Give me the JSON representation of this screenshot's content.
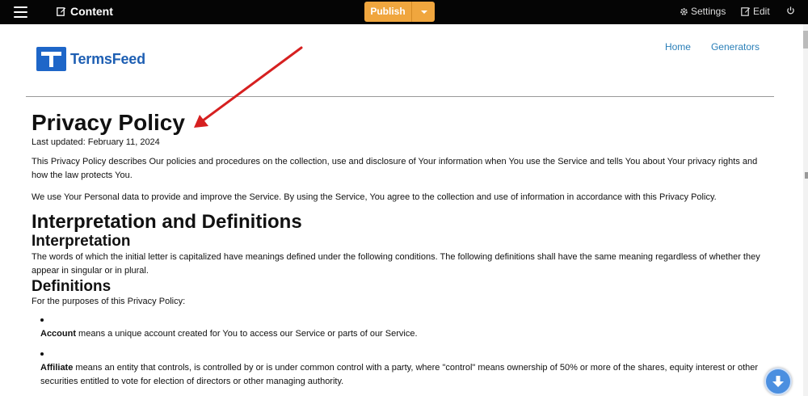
{
  "topbar": {
    "content_label": "Content",
    "publish_label": "Publish",
    "settings_label": "Settings",
    "edit_label": "Edit"
  },
  "site": {
    "brand": "TermsFeed",
    "nav": [
      "Home",
      "Generators"
    ]
  },
  "policy": {
    "title": "Privacy Policy",
    "updated": "Last updated: February 11, 2024",
    "intro1": "This Privacy Policy describes Our policies and procedures on the collection, use and disclosure of Your information when You use the Service and tells You about Your privacy rights and how the law protects You.",
    "intro2": "We use Your Personal data to provide and improve the Service. By using the Service, You agree to the collection and use of information in accordance with this Privacy Policy.",
    "section_heading": "Interpretation and Definitions",
    "interpretation_heading": "Interpretation",
    "interpretation_text": "The words of which the initial letter is capitalized have meanings defined under the following conditions. The following definitions shall have the same meaning regardless of whether they appear in singular or in plural.",
    "definitions_heading": "Definitions",
    "definitions_intro": "For the purposes of this Privacy Policy:",
    "definitions": [
      {
        "term": "Account",
        "text": " means a unique account created for You to access our Service or parts of our Service."
      },
      {
        "term": "Affiliate",
        "text": " means an entity that controls, is controlled by or is under common control with a party, where \"control\" means ownership of 50% or more of the shares, equity interest or other securities entitled to vote for election of directors or other managing authority."
      }
    ]
  },
  "colors": {
    "topbar_bg": "#050505",
    "publish": "#f0a63e",
    "brand_blue": "#1e66c8",
    "link": "#2a7fb8",
    "annotation_arrow": "#d62020"
  },
  "icons": [
    "menu-icon",
    "pencil-icon",
    "chevron-down-icon",
    "gear-icon",
    "edit-icon",
    "power-icon",
    "arrow-down-icon"
  ]
}
